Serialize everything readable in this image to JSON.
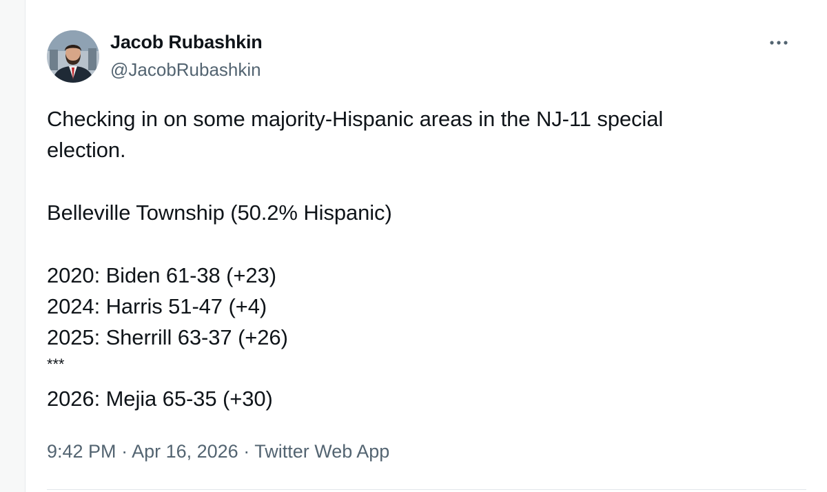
{
  "author": {
    "name": "Jacob Rubashkin",
    "handle": "@JacobRubashkin",
    "avatar_icon": "profile-photo"
  },
  "more_icon": "more-horizontal-icon",
  "tweet": {
    "intro": "Checking in on some majority-Hispanic areas in the NJ-11 special",
    "intro_cont": "election.",
    "place": "Belleville Township (50.2% Hispanic)",
    "results": [
      "2020: Biden 61-38 (+23)",
      "2024: Harris 51-47 (+4)",
      "2025: Sherrill 63-37 (+26)"
    ],
    "separator": "***",
    "latest": "2026: Mejia 65-35 (+30)"
  },
  "meta": {
    "time": "9:42 PM",
    "dot1": " · ",
    "date": "Apr 16, 2026",
    "dot2": " · ",
    "source": "Twitter Web App"
  },
  "colors": {
    "text": "#0f1419",
    "secondary": "#536471",
    "border": "#e1e6ea"
  }
}
